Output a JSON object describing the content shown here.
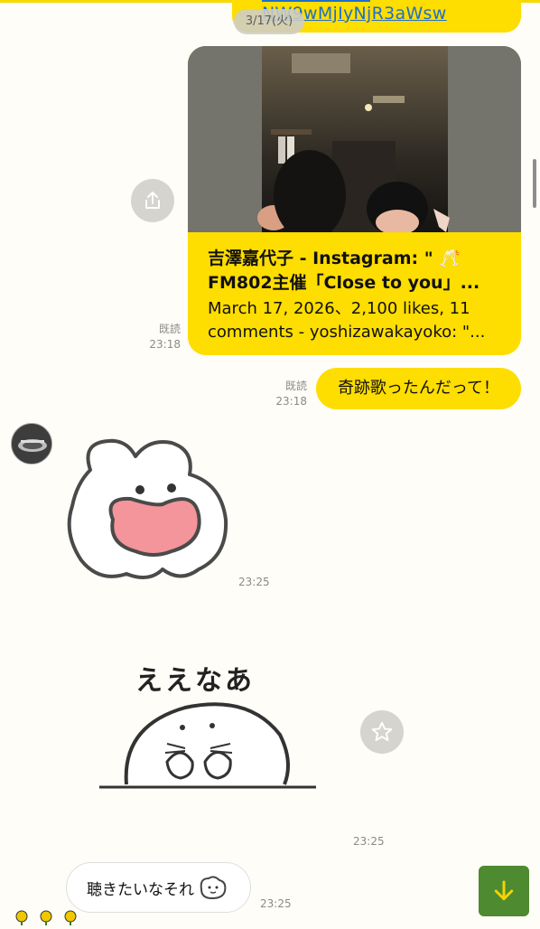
{
  "top_message": {
    "url_fragment": "NW9wMjIyNjR3aWsw"
  },
  "date_separator": "3/17(火)",
  "link_card": {
    "title_line1": "吉澤嘉代子 - Instagram: \" 🥂",
    "title_line2": "FM802主催「Close to you」...",
    "desc_line1": "March 17, 2026、2,100 likes, 11",
    "desc_line2": "comments - yoshizawakayoko: \"...",
    "read_label": "既読",
    "time": "23:18"
  },
  "my_message": {
    "text": "奇跡歌ったんだって！",
    "read_label": "既読",
    "time": "23:18"
  },
  "sticker1": {
    "time": "23:25"
  },
  "sticker2": {
    "caption": "ええなあ",
    "time": "23:25"
  },
  "their_message": {
    "text": "聴きたいなそれ",
    "time": "23:25"
  },
  "icons": {
    "share": "share-icon",
    "star": "star-icon",
    "scroll_down": "arrow-down-icon"
  },
  "colors": {
    "my_bubble": "#fedd00",
    "background": "#fffdf7",
    "scroll_button": "#4e8a2f"
  }
}
